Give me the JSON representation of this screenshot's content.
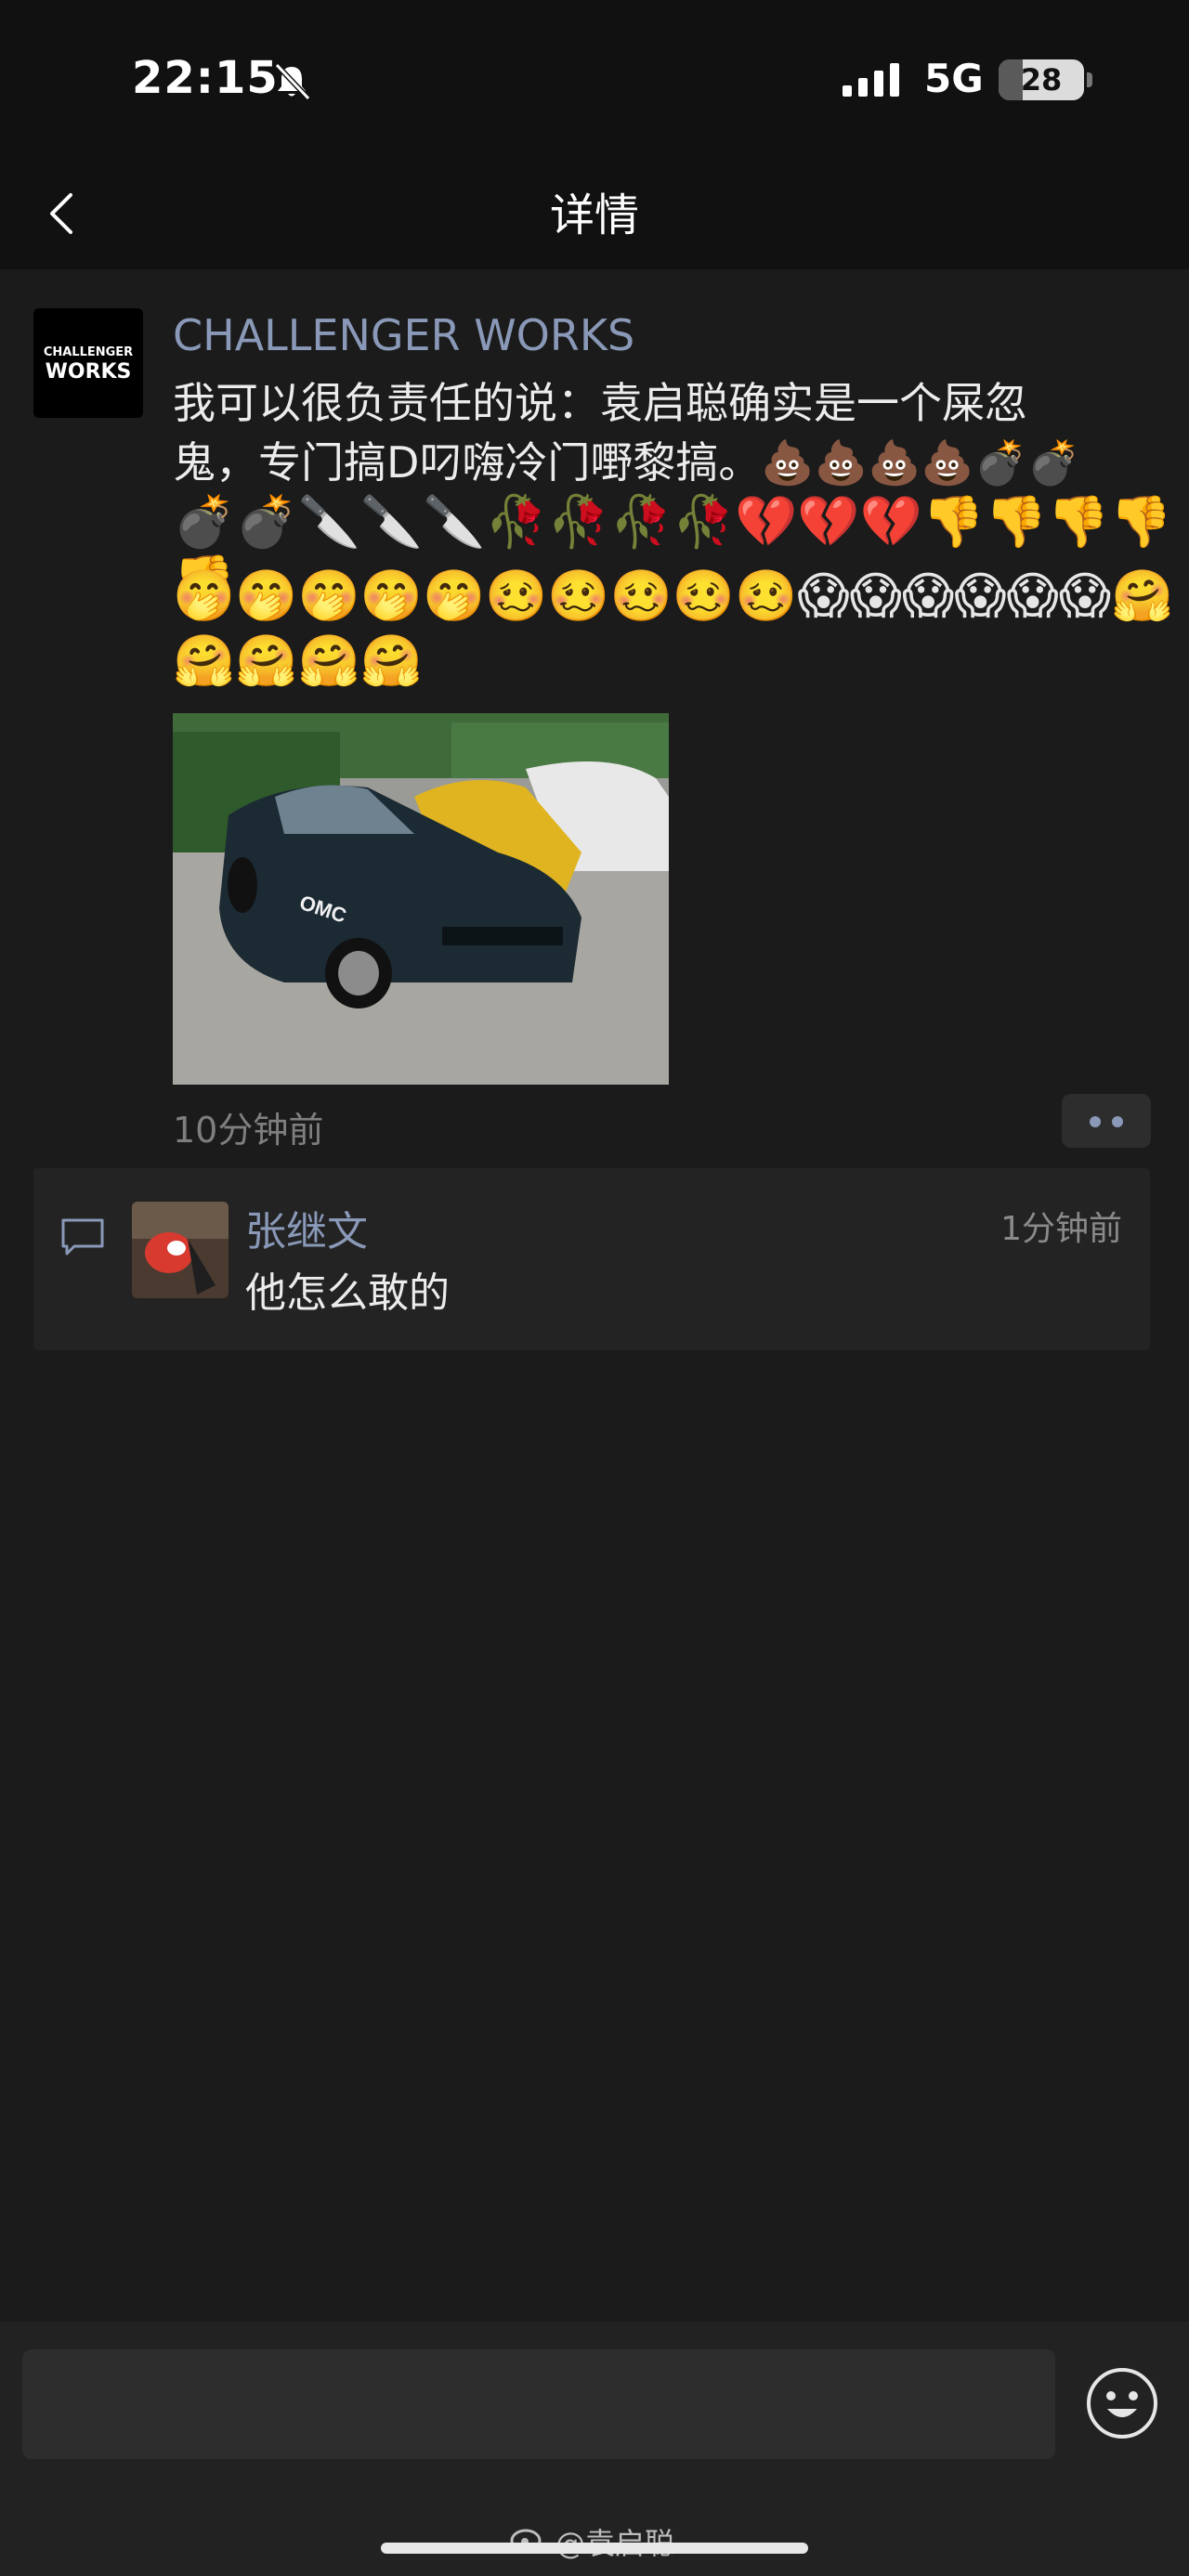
{
  "status_bar": {
    "time": "22:15",
    "network": "5G",
    "battery": "28",
    "battery_fraction": 0.28,
    "icons": [
      "bell-muted-icon",
      "signal-icon"
    ]
  },
  "nav": {
    "title": "详情",
    "back_icon": "chevron-left-icon"
  },
  "post": {
    "author": "CHALLENGER WORKS",
    "avatar_logo": {
      "top": "CHALLENGER",
      "bottom": "WORKS"
    },
    "text_line1": "我可以很负责任的说：袁启聪确实是一个屎忽",
    "text_line2": "鬼，专门搞D叼嗨冷门嘢黎搞。💩💩💩💩💣💣",
    "emoji_row1": "💣💣🔪🔪🔪🥀🥀🥀🥀💔💔💔👎👎👎👎👎",
    "emoji_row2": "🤭🤭🤭🤭🤭🥴🥴🥴🥴🥴😱😱😱😱😱😱🤗",
    "emoji_row3": "🤗🤗🤗🤗",
    "photo_label": "OMC",
    "timestamp": "10分钟前"
  },
  "comments": [
    {
      "name": "张继文",
      "time": "1分钟前",
      "text": "他怎么敢的"
    }
  ],
  "input_bar": {
    "placeholder": "",
    "emoji_icon": "smiley-icon"
  },
  "watermark": "@袁启聪",
  "colors": {
    "background": "#1b1b1b",
    "link_blue": "#8a99b8",
    "text": "#ececec",
    "muted": "#7f7f7f"
  }
}
